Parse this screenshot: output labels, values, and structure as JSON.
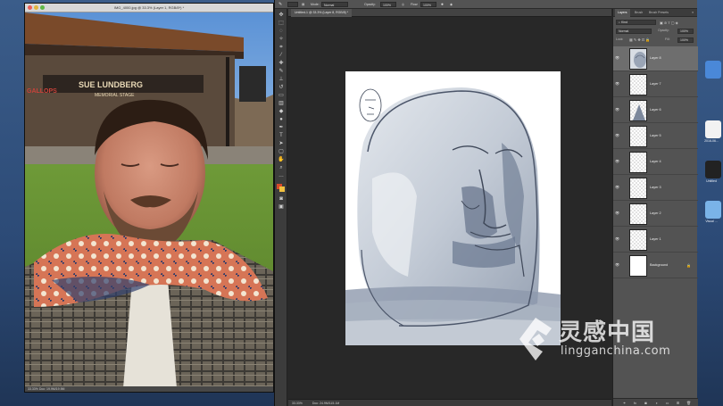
{
  "photo_window": {
    "title": "IMG_4000.jpg @ 33.3% (Layer 1, RGB/8*) *",
    "status": "33.33%   Doc: 19.9M/19.9M",
    "sign_line1": "SUE LUNDBERG",
    "sign_line2": "MEMORIAL STAGE",
    "sign_left": "GALLOPS"
  },
  "options_bar": {
    "mode_label": "Mode:",
    "mode_value": "Normal",
    "opacity_label": "Opacity:",
    "opacity_value": "100%",
    "flow_label": "Flow:",
    "flow_value": "100%"
  },
  "document": {
    "tab_label": "Untitled-1 @ 33.3% (Layer 8, RGB/8) *",
    "zoom": "33.33%",
    "doc_size": "Doc: 24.9M/115.1M"
  },
  "layers_panel": {
    "tabs": [
      "Layers",
      "Brush",
      "Brush Presets"
    ],
    "kind_label": "Kind",
    "blend_mode": "Normal",
    "opacity_label": "Opacity:",
    "opacity_value": "100%",
    "lock_label": "Lock:",
    "fill_label": "Fill:",
    "fill_value": "100%",
    "layers": [
      {
        "name": "Layer 8",
        "selected": true,
        "thumb": "sketch"
      },
      {
        "name": "Layer 7",
        "selected": false,
        "thumb": "checker"
      },
      {
        "name": "Layer 6",
        "selected": false,
        "thumb": "shape"
      },
      {
        "name": "Layer 5",
        "selected": false,
        "thumb": "checker"
      },
      {
        "name": "Layer 4",
        "selected": false,
        "thumb": "checker"
      },
      {
        "name": "Layer 3",
        "selected": false,
        "thumb": "checker"
      },
      {
        "name": "Layer 2",
        "selected": false,
        "thumb": "checker"
      },
      {
        "name": "Layer 1",
        "selected": false,
        "thumb": "checker"
      },
      {
        "name": "Background",
        "selected": false,
        "thumb": "white"
      }
    ]
  },
  "watermark": {
    "cn": "灵感中国",
    "en": "lingganchina.com"
  },
  "desktop": {
    "label_a": "2016-06...",
    "label_b": "Untitled",
    "label_c": "Visual ..."
  },
  "colors": {
    "ps_panel": "#535353",
    "ps_dark": "#282828",
    "accent_sky": "#4a7fc0",
    "scarf": "#d46a4a"
  }
}
